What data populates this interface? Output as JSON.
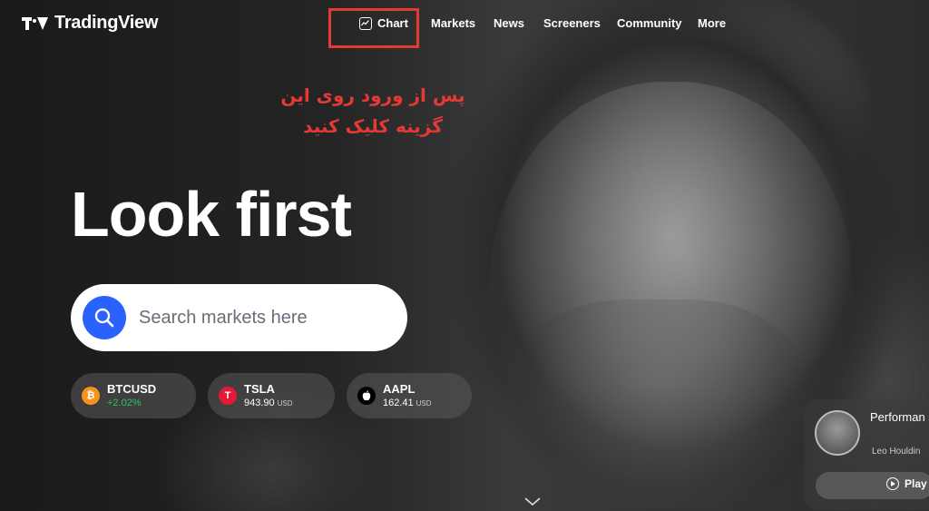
{
  "header": {
    "logo_text": "TradingView",
    "nav": [
      {
        "label": "Chart",
        "icon": "chart-icon"
      },
      {
        "label": "Markets"
      },
      {
        "label": "News"
      },
      {
        "label": "Screeners"
      },
      {
        "label": "Community"
      },
      {
        "label": "More"
      }
    ]
  },
  "annotation": {
    "line1": "پس از ورود روی این",
    "line2": "گزینه کلیک کنید",
    "color": "#e53935"
  },
  "hero": {
    "headline": "Look first",
    "search_placeholder": "Search markets here"
  },
  "tickers": [
    {
      "symbol": "BTCUSD",
      "change": "+2.02%",
      "icon": "bitcoin-icon",
      "color": "#f7931a"
    },
    {
      "symbol": "TSLA",
      "price": "943.90",
      "currency": "USD",
      "icon": "tesla-icon",
      "color": "#e31937"
    },
    {
      "symbol": "AAPL",
      "price": "162.41",
      "currency": "USD",
      "icon": "apple-icon",
      "color": "#000000"
    }
  ],
  "promo": {
    "title": "Performan success thr",
    "author": "Leo Houldin",
    "play_label": "Play"
  },
  "colors": {
    "accent": "#2962ff",
    "search_bg": "#ffffff",
    "positive": "#22c55e"
  }
}
